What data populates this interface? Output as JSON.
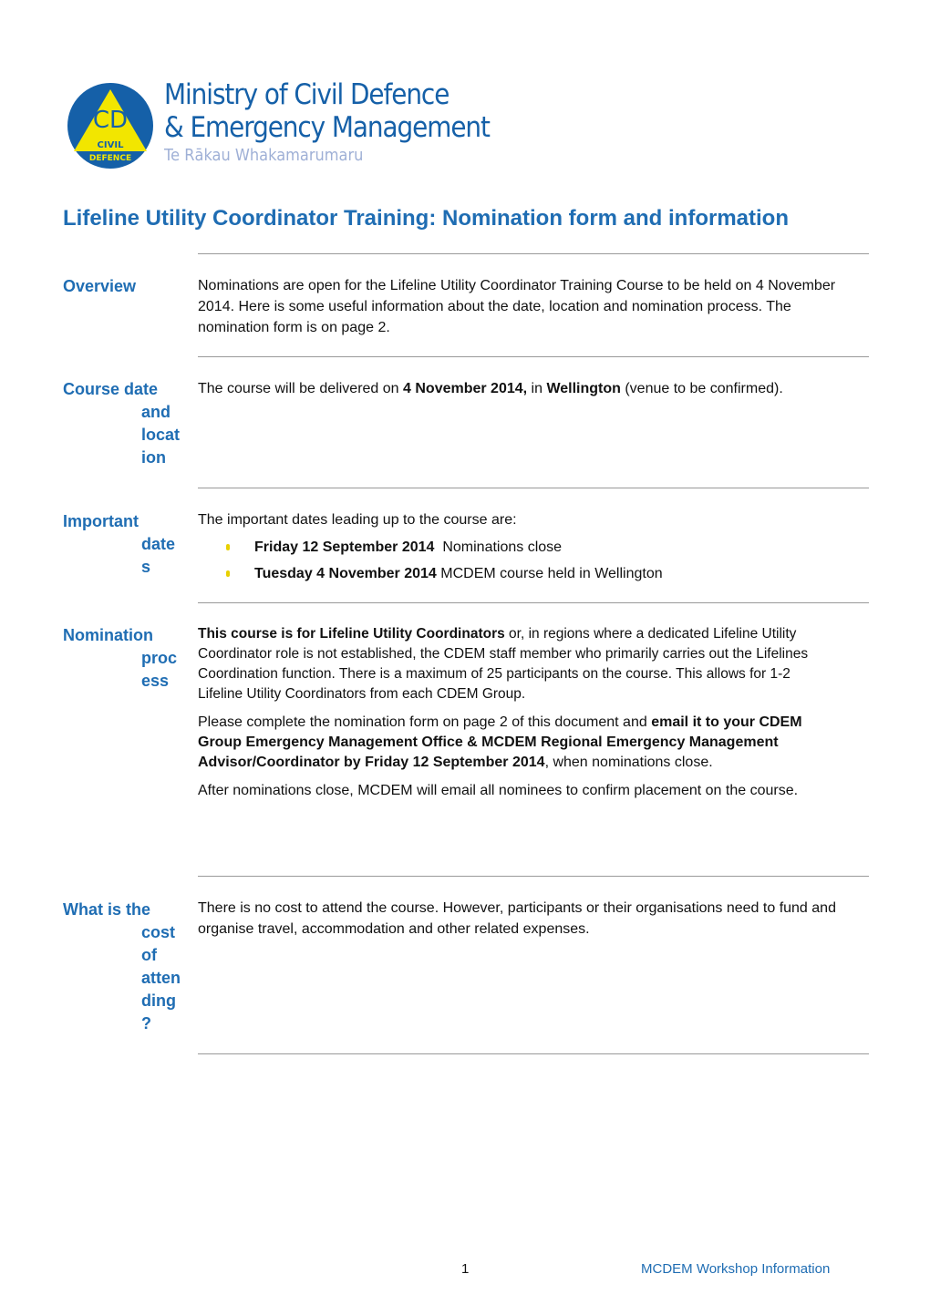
{
  "logo": {
    "emblem_top": "CD",
    "emblem_bottom": "CIVIL DEFENCE",
    "line1": "Ministry of Civil Defence",
    "line2": "& Emergency Management",
    "line3": "Te Rākau Whakamarumaru",
    "colors": {
      "blue": "#1560a8",
      "yellow": "#f2e600"
    }
  },
  "title": "Lifeline Utility Coordinator Training: Nomination form and information",
  "sections": {
    "overview": {
      "label": "Overview",
      "text": "Nominations are open for the Lifeline Utility Coordinator Training Course to be held on 4 November 2014. Here is some useful information about the date, location and nomination process. The nomination form is on page 2."
    },
    "course": {
      "label": "Course date and location",
      "t1": "The course will be delivered on ",
      "b1": "4 November 2014,",
      "t2": " in ",
      "b2": "Wellington",
      "t3": " (venue to be confirmed)."
    },
    "dates": {
      "label": "Important dates",
      "intro": "The important dates leading up to the course are:",
      "items": [
        {
          "bold": "Friday 12 September 2014",
          "text": "  Nominations close"
        },
        {
          "bold": "Tuesday 4 November 2014",
          "text": " MCDEM course held in Wellington"
        }
      ]
    },
    "nomination": {
      "label": "Nomination process",
      "p1b": "This course is for Lifeline Utility Coordinators",
      "p1": " or, in regions where a dedicated Lifeline Utility Coordinator role is not established, the CDEM staff member who primarily carries out the Lifelines Coordination function. There is a maximum of 25 participants on the course. This allows for 1-2 Lifeline Utility Coordinators from each CDEM Group.",
      "p2a": "Please complete the nomination form on page 2 of this document and ",
      "p2b": "email it to your CDEM Group Emergency Management Office & MCDEM Regional Emergency Management Advisor/Coordinator by Friday 12 September 2014",
      "p2c": ", when nominations close.",
      "p3": "After nominations close, MCDEM will email all nominees to confirm placement on the course."
    },
    "cost": {
      "label": "What is the cost of attending?",
      "text": "There is no cost to attend the course. However, participants or their organisations need to fund and organise travel, accommodation and other related expenses."
    }
  },
  "footer": {
    "page": "1",
    "doc": "MCDEM Workshop Information"
  }
}
